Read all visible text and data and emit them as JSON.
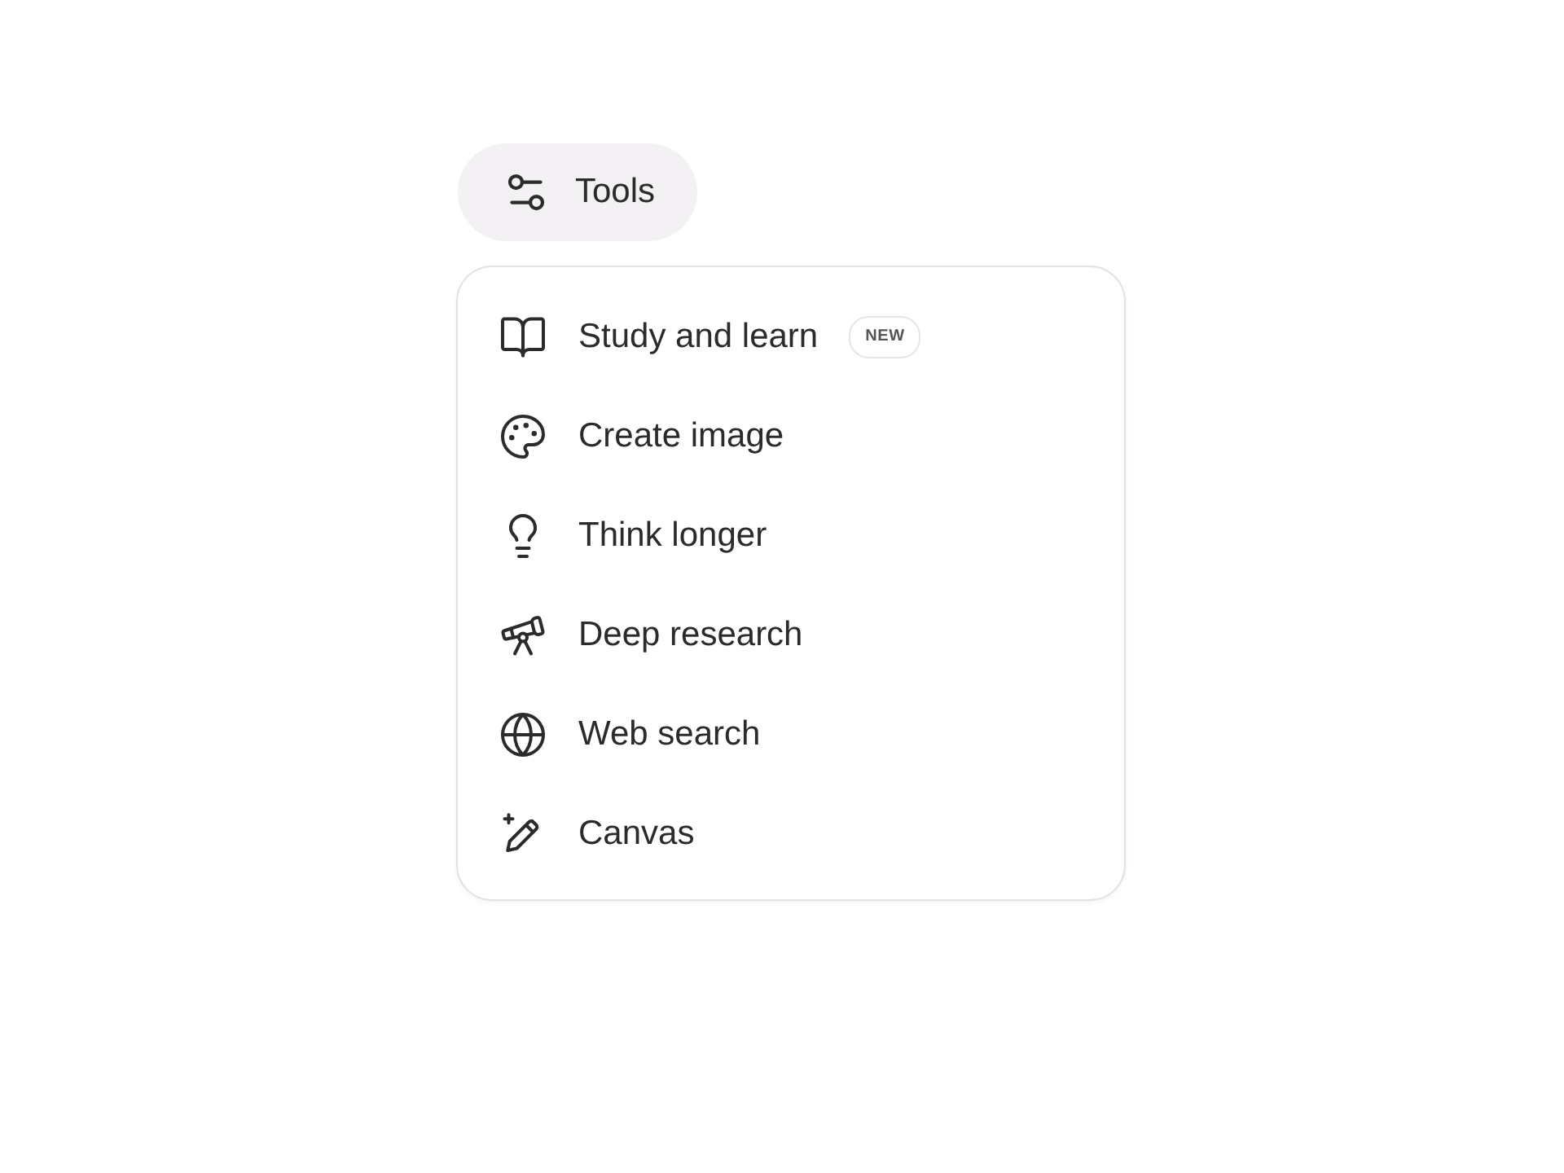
{
  "tools_button": {
    "label": "Tools"
  },
  "menu": {
    "items": [
      {
        "label": "Study and learn",
        "badge": "NEW"
      },
      {
        "label": "Create image"
      },
      {
        "label": "Think longer"
      },
      {
        "label": "Deep research"
      },
      {
        "label": "Web search"
      },
      {
        "label": "Canvas"
      }
    ]
  }
}
